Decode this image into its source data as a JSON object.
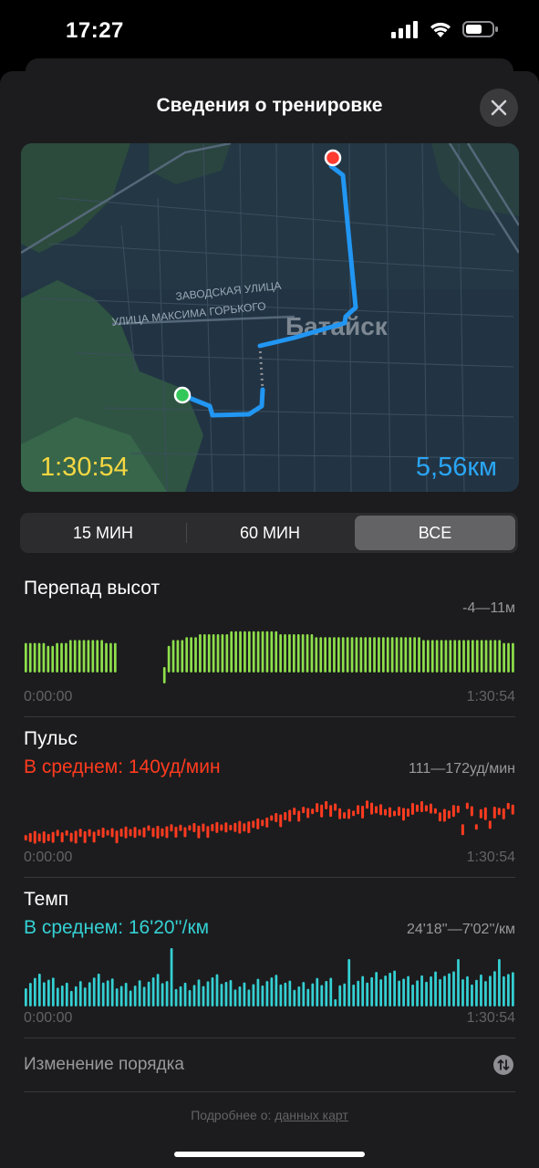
{
  "status_bar": {
    "time": "17:27"
  },
  "header": {
    "title": "Сведения о тренировке"
  },
  "map": {
    "street_1": "ЗАВОДСКАЯ УЛИЦА",
    "street_2": "УЛИЦА МАКСИМА ГОРЬКОГО",
    "city": "Батайск",
    "duration": "1:30:54",
    "distance": "5,56км"
  },
  "segments": [
    {
      "label": "15 МИН",
      "active": false
    },
    {
      "label": "60 МИН",
      "active": false
    },
    {
      "label": "ВСЕ",
      "active": true
    }
  ],
  "elevation": {
    "title": "Перепад высот",
    "range": "-4—11м",
    "start": "0:00:00",
    "end": "1:30:54",
    "color": "#8ee04b",
    "values": [
      7,
      7,
      7,
      7,
      7,
      6,
      6,
      7,
      7,
      7,
      8,
      8,
      8,
      8,
      8,
      8,
      8,
      8,
      7,
      7,
      7,
      null,
      null,
      null,
      null,
      null,
      null,
      null,
      null,
      null,
      null,
      -4,
      6,
      8,
      8,
      8,
      9,
      9,
      9,
      10,
      10,
      10,
      10,
      10,
      10,
      10,
      11,
      11,
      11,
      11,
      11,
      11,
      11,
      11,
      11,
      11,
      11,
      10,
      10,
      10,
      10,
      10,
      10,
      10,
      10,
      9,
      9,
      9,
      9,
      9,
      9,
      9,
      9,
      9,
      9,
      9,
      9,
      9,
      9,
      9,
      9,
      9,
      9,
      9,
      9,
      9,
      9,
      9,
      9,
      8,
      8,
      8,
      8,
      8,
      8,
      8,
      8,
      8,
      8,
      8,
      8,
      8,
      8,
      8,
      8,
      8,
      8,
      7,
      7,
      7
    ]
  },
  "pulse": {
    "title": "Пульс",
    "avg": "В среднем: 140уд/мин",
    "range": "111—172уд/мин",
    "start": "0:00:00",
    "end": "1:30:54",
    "color": "#ff3b1f",
    "min": 111,
    "max": 172
  },
  "pace": {
    "title": "Темп",
    "avg": "В среднем: 16'20''/км",
    "range": "24'18''—7'02''/км",
    "start": "0:00:00",
    "end": "1:30:54",
    "color": "#35d0d3"
  },
  "reorder": {
    "label": "Изменение порядка",
    "icon": "swap-vertical-icon"
  },
  "footer": {
    "prefix": "Подробнее о:",
    "link": "данных карт"
  }
}
